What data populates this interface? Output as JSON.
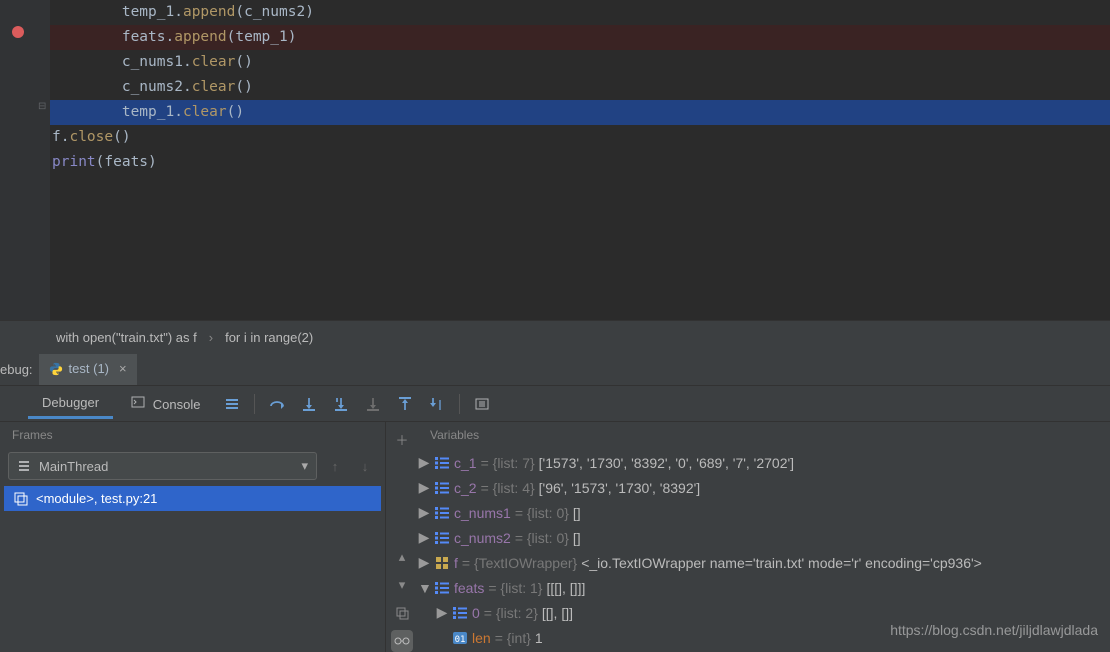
{
  "code": {
    "lines": [
      {
        "indent": "        ",
        "tokens": [
          {
            "t": "temp_1",
            "c": "ident"
          },
          {
            "t": ".",
            "c": "ident"
          },
          {
            "t": "append",
            "c": "fn"
          },
          {
            "t": "(c_nums2)",
            "c": "ident"
          }
        ],
        "cls": ""
      },
      {
        "indent": "        ",
        "tokens": [
          {
            "t": "feats",
            "c": "ident"
          },
          {
            "t": ".",
            "c": "ident"
          },
          {
            "t": "append",
            "c": "fn"
          },
          {
            "t": "(temp_1)",
            "c": "ident"
          }
        ],
        "cls": "bp-line"
      },
      {
        "indent": "        ",
        "tokens": [
          {
            "t": "c_nums1",
            "c": "ident"
          },
          {
            "t": ".",
            "c": "ident"
          },
          {
            "t": "clear",
            "c": "fn"
          },
          {
            "t": "()",
            "c": "ident"
          }
        ],
        "cls": ""
      },
      {
        "indent": "        ",
        "tokens": [
          {
            "t": "c_nums2",
            "c": "ident"
          },
          {
            "t": ".",
            "c": "ident"
          },
          {
            "t": "clear",
            "c": "fn"
          },
          {
            "t": "()",
            "c": "ident"
          }
        ],
        "cls": ""
      },
      {
        "indent": "        ",
        "tokens": [
          {
            "t": "temp_1",
            "c": "ident"
          },
          {
            "t": ".",
            "c": "ident"
          },
          {
            "t": "clear",
            "c": "fn"
          },
          {
            "t": "()",
            "c": "ident"
          }
        ],
        "cls": "hl"
      },
      {
        "indent": "",
        "tokens": [
          {
            "t": "f",
            "c": "ident"
          },
          {
            "t": ".",
            "c": "ident"
          },
          {
            "t": "close",
            "c": "fn"
          },
          {
            "t": "()",
            "c": "ident"
          }
        ],
        "cls": ""
      },
      {
        "indent": "",
        "tokens": [
          {
            "t": "print",
            "c": "builtin"
          },
          {
            "t": "(feats)",
            "c": "ident"
          }
        ],
        "cls": ""
      }
    ]
  },
  "breadcrumb": {
    "item1": "with open(\"train.txt\") as f",
    "item2": "for i in range(2)"
  },
  "debug": {
    "label": "ebug:",
    "tab_name": "test (1)",
    "debugger_tab": "Debugger",
    "console_tab": "Console"
  },
  "frames": {
    "title": "Frames",
    "thread": "MainThread",
    "item": "<module>, test.py:21"
  },
  "variables": {
    "title": "Variables",
    "rows": [
      {
        "lvl": 0,
        "exp": "closed",
        "icon": "list",
        "name": "c_1",
        "type": " = {list: 7} ",
        "val": "['1573', '1730', '8392', '0', '689', '7', '2702']"
      },
      {
        "lvl": 0,
        "exp": "closed",
        "icon": "list",
        "name": "c_2",
        "type": " = {list: 4} ",
        "val": "['96', '1573', '1730', '8392']"
      },
      {
        "lvl": 0,
        "exp": "closed",
        "icon": "list",
        "name": "c_nums1",
        "type": " = {list: 0} ",
        "val": "[]"
      },
      {
        "lvl": 0,
        "exp": "closed",
        "icon": "list",
        "name": "c_nums2",
        "type": " = {list: 0} ",
        "val": "[]"
      },
      {
        "lvl": 0,
        "exp": "closed",
        "icon": "obj",
        "name": "f",
        "type": " = {TextIOWrapper} ",
        "val": "<_io.TextIOWrapper name='train.txt' mode='r' encoding='cp936'>"
      },
      {
        "lvl": 0,
        "exp": "open",
        "icon": "list",
        "name": "feats",
        "type": " = {list: 1} ",
        "val": "[[[], []]]"
      },
      {
        "lvl": 1,
        "exp": "closed",
        "icon": "list",
        "name": "0",
        "type": " = {list: 2} ",
        "val": "[[], []]"
      },
      {
        "lvl": 1,
        "exp": "none",
        "icon": "int",
        "name": "len",
        "nameColor": "special",
        "type": "    = {int} ",
        "val": "1"
      }
    ]
  },
  "watermark": "https://blog.csdn.net/jiljdlawjdlada"
}
